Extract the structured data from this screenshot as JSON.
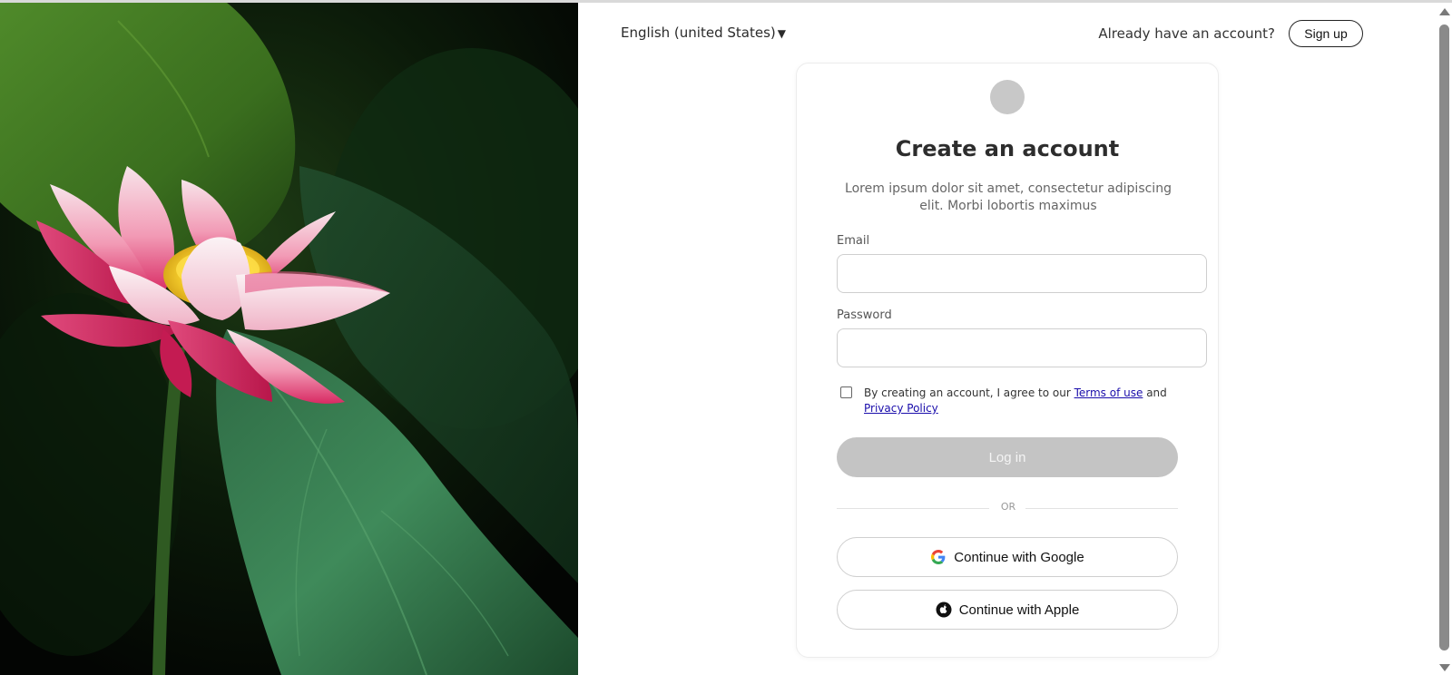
{
  "header": {
    "language": "English (united States)",
    "language_caret": "▼",
    "already_have_account": "Already have an account?",
    "signup_label": "Sign up"
  },
  "card": {
    "title": "Create an account",
    "subtitle": "Lorem ipsum dolor sit amet, consectetur adipiscing elit. Morbi lobortis maximus",
    "email_label": "Email",
    "email_value": "",
    "password_label": "Password",
    "password_value": "",
    "agree_prefix": "By creating an account, I agree to our",
    "terms_label": "Terms of use",
    "agree_and": "and",
    "privacy_label": "Privacy Policy",
    "agree_checked": false,
    "login_label": "Log in",
    "divider_text": "OR",
    "google_label": "Continue with Google",
    "apple_label": "Continue with Apple"
  },
  "icons": {
    "google": "google-icon",
    "apple": "apple-icon",
    "dropdown": "caret-down-icon"
  },
  "colors": {
    "login_button_disabled": "#c4c4c4",
    "link": "#1a0dab",
    "logo_placeholder": "#c8c8c8"
  }
}
